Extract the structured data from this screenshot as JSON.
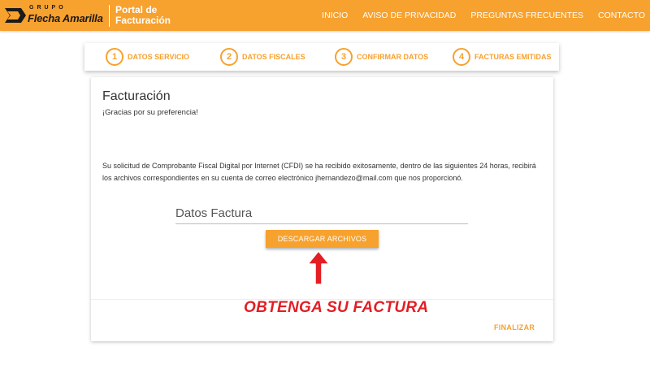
{
  "header": {
    "logo_group": "GRUPO",
    "logo_brand": "Flecha Amarilla",
    "portal_title": "Portal de Facturación",
    "nav": [
      "INICIO",
      "AVISO DE PRIVACIDAD",
      "PREGUNTAS FRECUENTES",
      "CONTACTO"
    ]
  },
  "steps": [
    {
      "number": "1",
      "label": "DATOS SERVICIO"
    },
    {
      "number": "2",
      "label": "DATOS FISCALES"
    },
    {
      "number": "3",
      "label": "CONFIRMAR DATOS"
    },
    {
      "number": "4",
      "label": "FACTURAS EMITIDAS"
    }
  ],
  "card": {
    "title": "Facturación",
    "subtitle": "¡Gracias por su preferencia!",
    "message": "Su solicitud de Comprobante Fiscal Digital por Internet (CFDI) se ha recibido exitosamente, dentro de las siguientes 24 horas, recibirá los archivos correspondientes en su cuenta de correo electrónico jhernandezo@mail.com que nos proporcionó.",
    "datos_label": "Datos Factura",
    "download_label": "DESCARGAR ARCHIVOS",
    "finalize_label": "FINALIZAR"
  },
  "annotation": {
    "text": "OBTENGA SU FACTURA"
  },
  "colors": {
    "brand": "#f7a12e",
    "annotation": "#e31e24"
  },
  "icons": {
    "logo": "flecha-logo-icon",
    "arrow": "arrow-up-icon"
  }
}
